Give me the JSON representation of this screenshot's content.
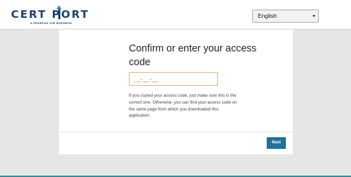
{
  "header": {
    "logo": {
      "brand": "CERT|PORT",
      "tagline": "A PEARSON VUE BUSINESS"
    },
    "language": {
      "selected": "English",
      "icon": "chevron-down-icon"
    }
  },
  "main": {
    "heading": "Confirm or enter your access code",
    "code_input": {
      "placeholder": "__-__-__"
    },
    "help_text": "If you copied your access code, just make sure this is the correct one. Otherwise, you can find your access code on the same page from which you downloaded this application.",
    "next_label": "Next"
  },
  "colors": {
    "brand_navy": "#1c3f6e",
    "accent_teal": "#2c9bb4",
    "button_blue": "#1f7399",
    "input_border": "#e3b56a",
    "page_background": "#e6e6e6"
  }
}
